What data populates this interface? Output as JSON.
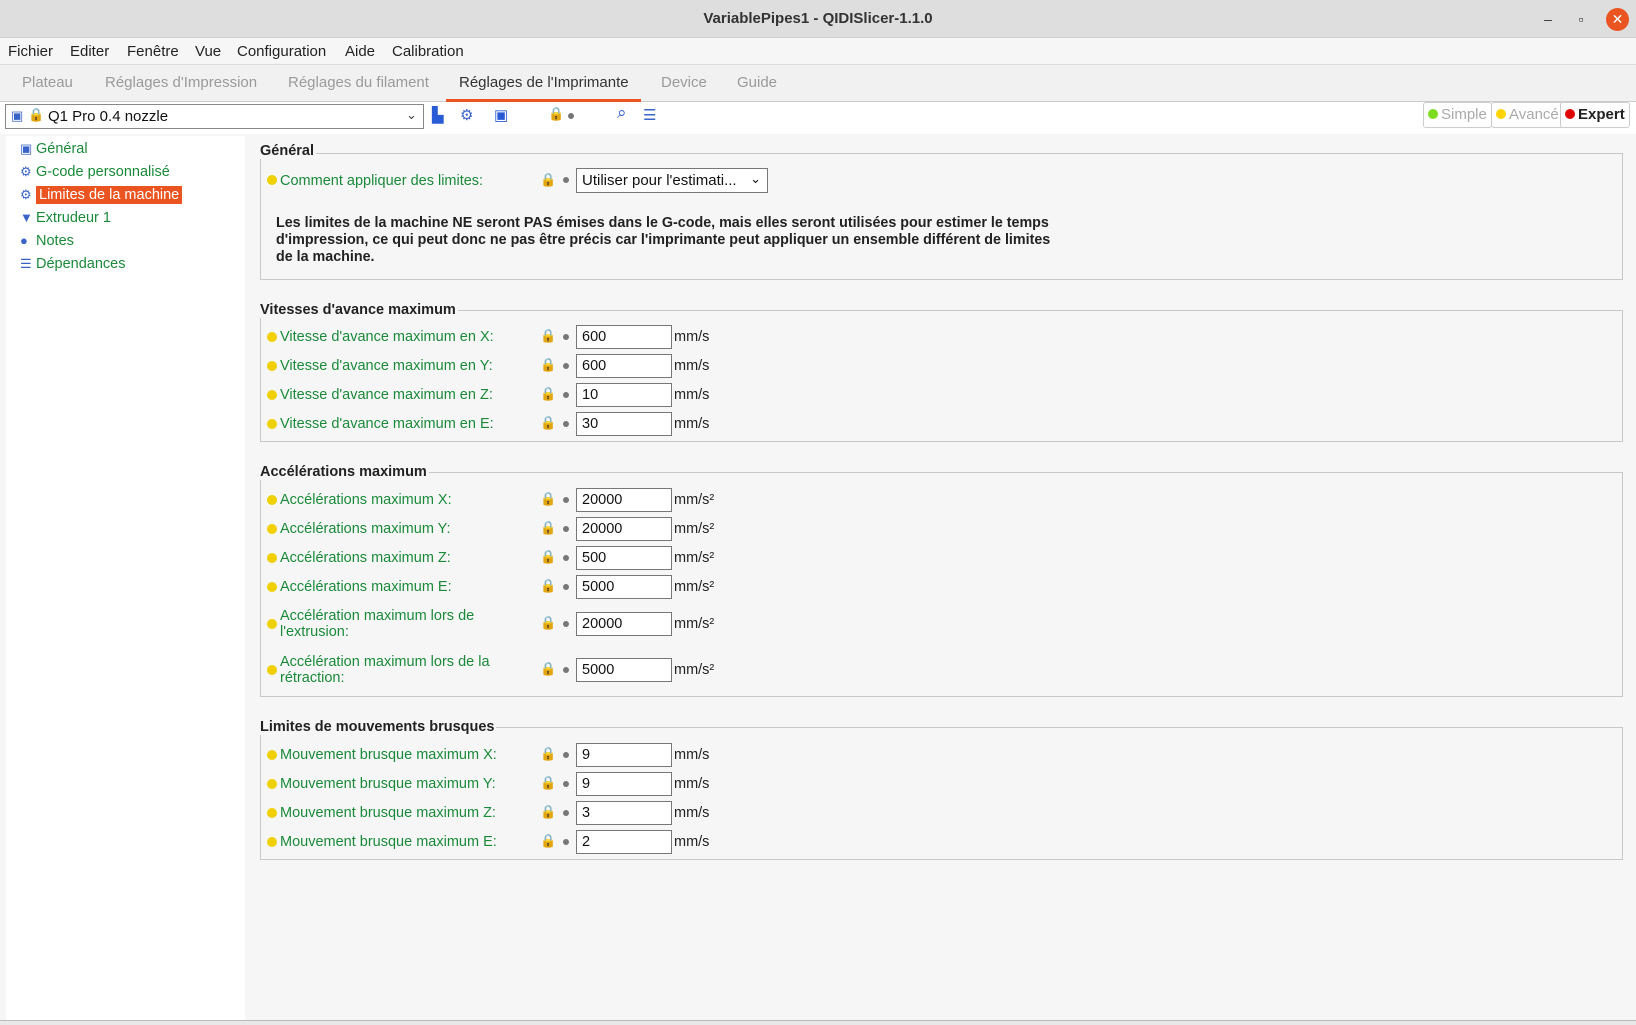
{
  "window": {
    "title": "VariablePipes1 - QIDISlicer-1.1.0",
    "minimize": "–",
    "maximize": "▫",
    "close": "✕"
  },
  "menu": [
    "Fichier",
    "Editer",
    "Fenêtre",
    "Vue",
    "Configuration",
    "Aide",
    "Calibration"
  ],
  "tabs": [
    "Plateau",
    "Réglages d'Impression",
    "Réglages du filament",
    "Réglages de l'Imprimante",
    "Device",
    "Guide"
  ],
  "active_tab": 3,
  "preset": {
    "value": "Q1 Pro 0.4 nozzle"
  },
  "modes": [
    {
      "label": "Simple",
      "color": "#7ddc1f"
    },
    {
      "label": "Avancé",
      "color": "#ffd200"
    },
    {
      "label": "Expert",
      "color": "#e00000"
    }
  ],
  "sidebar": [
    {
      "label": "Général",
      "icon": "printer-icon"
    },
    {
      "label": "G-code personnalisé",
      "icon": "gear-icon"
    },
    {
      "label": "Limites de la machine",
      "icon": "gear-icon",
      "selected": true
    },
    {
      "label": "Extrudeur 1",
      "icon": "extruder-icon"
    },
    {
      "label": "Notes",
      "icon": "speech-bubble-icon"
    },
    {
      "label": "Dépendances",
      "icon": "dependencies-icon"
    }
  ],
  "general": {
    "title": "Général",
    "label": "Comment appliquer des limites:",
    "value": "Utiliser pour l'estimati...",
    "note": "Les limites de la machine NE seront PAS émises dans le G-code, mais elles seront utilisées pour estimer le temps d'impression, ce qui peut donc ne pas être précis car l'imprimante peut appliquer un ensemble différent de limites de la machine."
  },
  "feed": {
    "title": "Vitesses d'avance maximum",
    "rows": [
      {
        "label": "Vitesse d'avance maximum en X:",
        "value": "600",
        "unit": "mm/s"
      },
      {
        "label": "Vitesse d'avance maximum en Y:",
        "value": "600",
        "unit": "mm/s"
      },
      {
        "label": "Vitesse d'avance maximum en Z:",
        "value": "10",
        "unit": "mm/s"
      },
      {
        "label": "Vitesse d'avance maximum en E:",
        "value": "30",
        "unit": "mm/s"
      }
    ]
  },
  "accel": {
    "title": "Accélérations maximum",
    "rows": [
      {
        "label": "Accélérations maximum X:",
        "value": "20000",
        "unit": "mm/s²"
      },
      {
        "label": "Accélérations maximum Y:",
        "value": "20000",
        "unit": "mm/s²"
      },
      {
        "label": "Accélérations maximum Z:",
        "value": "500",
        "unit": "mm/s²"
      },
      {
        "label": "Accélérations maximum E:",
        "value": "5000",
        "unit": "mm/s²"
      },
      {
        "label": "Accélération maximum lors de l'extrusion:",
        "value": "20000",
        "unit": "mm/s²"
      },
      {
        "label": "Accélération maximum lors de la rétraction:",
        "value": "5000",
        "unit": "mm/s²"
      }
    ]
  },
  "jerk": {
    "title": "Limites de mouvements brusques",
    "rows": [
      {
        "label": "Mouvement brusque maximum X:",
        "value": "9",
        "unit": "mm/s"
      },
      {
        "label": "Mouvement brusque maximum Y:",
        "value": "9",
        "unit": "mm/s"
      },
      {
        "label": "Mouvement brusque maximum Z:",
        "value": "3",
        "unit": "mm/s"
      },
      {
        "label": "Mouvement brusque maximum E:",
        "value": "2",
        "unit": "mm/s"
      }
    ]
  }
}
